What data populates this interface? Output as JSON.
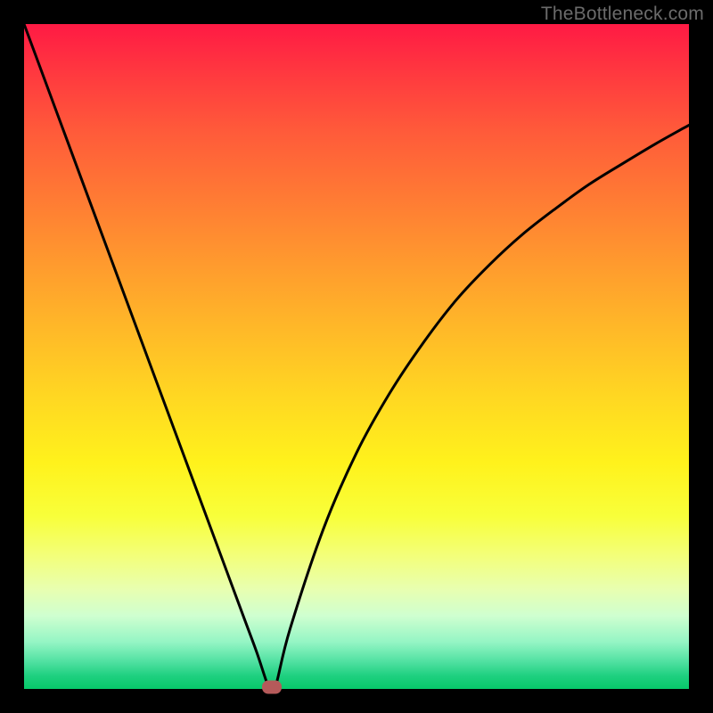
{
  "watermark": "TheBottleneck.com",
  "chart_data": {
    "type": "line",
    "title": "",
    "xlabel": "",
    "ylabel": "",
    "xlim": [
      0,
      100
    ],
    "ylim": [
      0,
      100
    ],
    "grid": false,
    "legend": null,
    "series": [
      {
        "name": "bottleneck-curve",
        "x": [
          0,
          5,
          10,
          15,
          20,
          25,
          30,
          33,
          35,
          36.5,
          37,
          37.5,
          38,
          40,
          45,
          50,
          55,
          60,
          65,
          70,
          75,
          80,
          85,
          90,
          95,
          100
        ],
        "y": [
          100,
          86.5,
          73,
          59.5,
          46,
          32.5,
          19,
          10.9,
          5.5,
          1.0,
          0.2,
          0.2,
          1.0,
          9,
          24,
          35.5,
          44.5,
          52,
          58.5,
          63.8,
          68.4,
          72.3,
          75.9,
          79.0,
          82.0,
          84.8
        ]
      }
    ],
    "marker": {
      "x": 37.2,
      "y": 0.3,
      "label": "optimal-point"
    },
    "colors": {
      "curve": "#000000",
      "marker": "#b55a5a",
      "gradient_top": "#ff1a44",
      "gradient_mid": "#ffe01f",
      "gradient_bottom": "#07c96a",
      "frame": "#000000"
    }
  }
}
